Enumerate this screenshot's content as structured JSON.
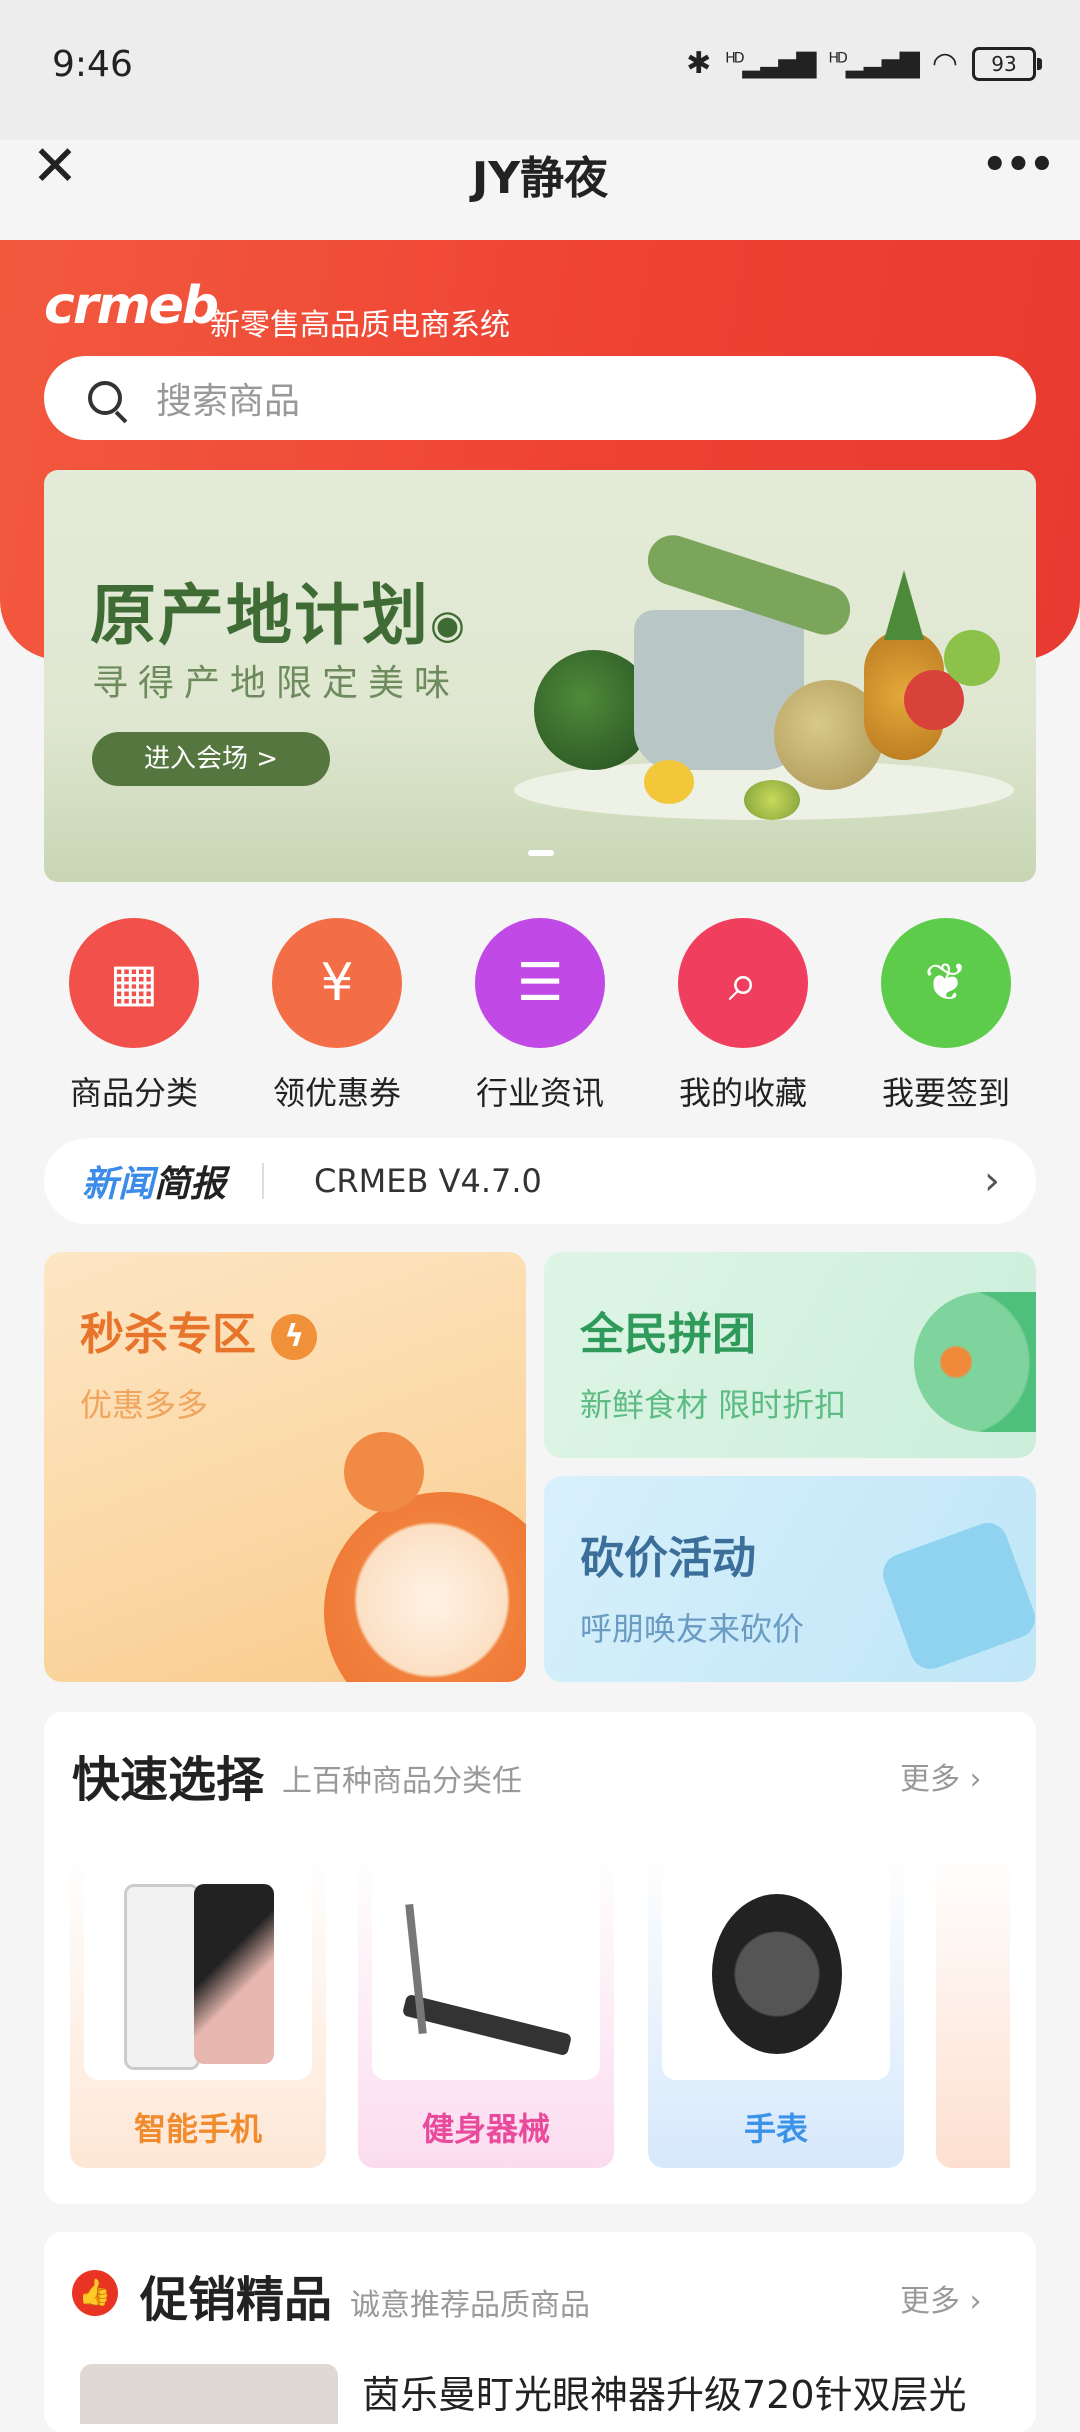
{
  "status_bar": {
    "time": "9:46",
    "battery": "93",
    "network": "HD"
  },
  "title_bar": {
    "title": "JY静夜"
  },
  "header": {
    "logo": "crmeb",
    "slogan": "新零售高品质电商系统",
    "search_placeholder": "搜索商品"
  },
  "banner": {
    "title": "原产地计划",
    "subtitle": "寻得产地限定美味",
    "button": "进入会场 >"
  },
  "nav": [
    {
      "label": "商品分类",
      "icon": "grid-icon",
      "color": "#f2504b"
    },
    {
      "label": "领优惠券",
      "icon": "coupon-icon",
      "color": "#f36e46"
    },
    {
      "label": "行业资讯",
      "icon": "document-icon",
      "color": "#c149e6"
    },
    {
      "label": "我的收藏",
      "icon": "magnifier-icon",
      "color": "#f03f5e"
    },
    {
      "label": "我要签到",
      "icon": "leaf-icon",
      "color": "#5dcc4a"
    }
  ],
  "news": {
    "tag_part1": "新闻",
    "tag_part2": "简报",
    "text": "CRMEB V4.7.0"
  },
  "promos": {
    "seckill": {
      "title": "秒杀专区",
      "subtitle": "优惠多多"
    },
    "group": {
      "title": "全民拼团",
      "subtitle": "新鲜食材 限时折扣"
    },
    "bargain": {
      "title": "砍价活动",
      "subtitle": "呼朋唤友来砍价"
    }
  },
  "quick_select": {
    "title": "快速选择",
    "subtitle": "上百种商品分类任",
    "more": "更多",
    "items": [
      {
        "label": "智能手机",
        "color": "#f28a2e"
      },
      {
        "label": "健身器械",
        "color": "#e94a9c"
      },
      {
        "label": "手表",
        "color": "#3b93e8"
      }
    ]
  },
  "promo_products": {
    "title": "促销精品",
    "subtitle": "诚意推荐品质商品",
    "more": "更多",
    "first_item": "茵乐曼盯光眼神器升级720针双层光"
  },
  "colors": {
    "brand_red": "#e93323",
    "accent_orange": "#f28a2e"
  }
}
